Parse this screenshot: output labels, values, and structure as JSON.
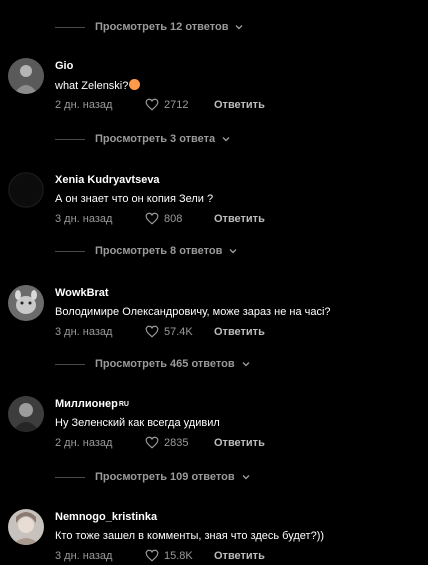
{
  "view_replies": [
    "Просмотреть 12 ответов",
    "Просмотреть 3 ответа",
    "Просмотреть 8 ответов",
    "Просмотреть 465 ответов",
    "Просмотреть 109 ответов"
  ],
  "reply_label": "Ответить",
  "comments": [
    {
      "username": "Gio",
      "text": "what Zelenski?",
      "emoji": "smiling-face-with-hearts",
      "date": "2 дн. назад",
      "likes": "2712"
    },
    {
      "username": "Xenia Kudryavtseva",
      "text": "А он знает что он копия Зели ?",
      "date": "3 дн. назад",
      "likes": "808"
    },
    {
      "username": "WowkBrat",
      "text": "Володимире Олександровичу, може зараз не на часі?",
      "date": "3 дн. назад",
      "likes": "57.4K"
    },
    {
      "username": "Миллионер",
      "username_badge": "RU",
      "text": "Ну Зеленский как всегда удивил",
      "date": "2 дн. назад",
      "likes": "2835"
    },
    {
      "username": "Nemnogo_kristinka",
      "text": "Кто тоже зашел в комменты, зная что здесь будет?))",
      "date": "3 дн. назад",
      "likes": "15.8K"
    }
  ],
  "colors": {
    "background": "#000000",
    "secondary_text": "#9a9a9a",
    "primary_text": "#ffffff"
  }
}
